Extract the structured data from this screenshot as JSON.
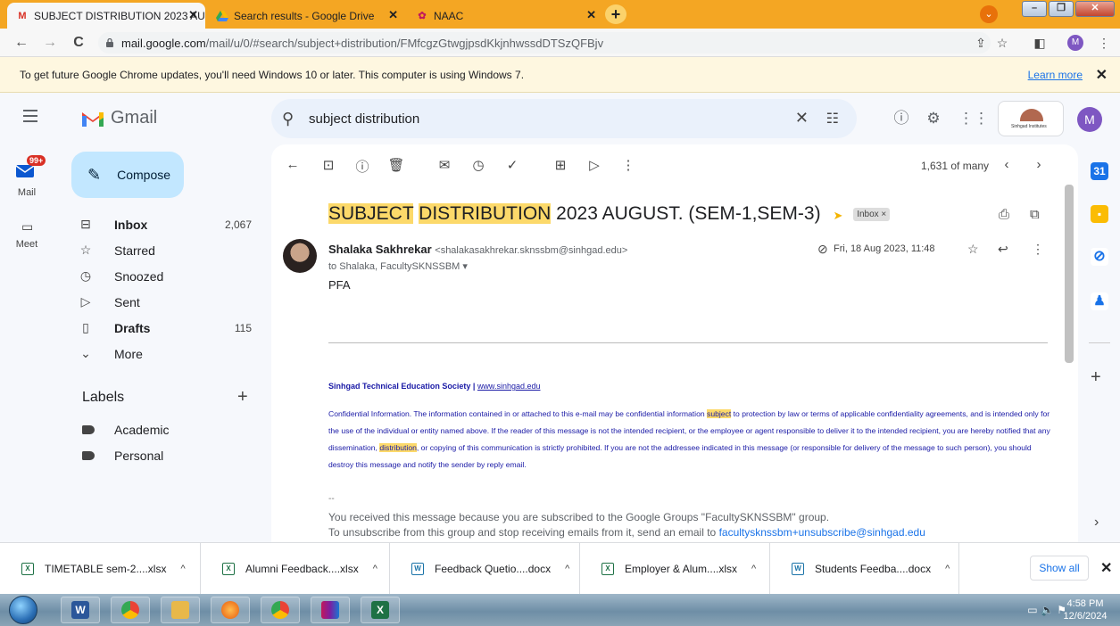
{
  "browser": {
    "tabs": [
      {
        "label": "SUBJECT DISTRIBUTION 2023 AU",
        "active": true
      },
      {
        "label": "Search results - Google Drive",
        "active": false
      },
      {
        "label": "NAAC",
        "active": false
      }
    ],
    "new_tab": "+",
    "profile_initial": "M",
    "url_host": "mail.google.com",
    "url_path": "/mail/u/0/#search/subject+distribution/FMfcgzGtwgjpsdKkjnhwssdDTSzQFBjv"
  },
  "infobar": {
    "text": "To get future Google Chrome updates, you'll need Windows 10 or later. This computer is using Windows 7.",
    "link": "Learn more"
  },
  "gmail": {
    "app_name": "Gmail",
    "search_value": "subject distribution",
    "org_caption": "Sinhgad Institutes",
    "user_initial": "M"
  },
  "rail": {
    "mail_badge": "99+",
    "mail_label": "Mail",
    "meet_label": "Meet"
  },
  "sidebar": {
    "compose": "Compose",
    "items": [
      {
        "label": "Inbox",
        "count": "2,067",
        "bold": true,
        "icon": "inbox-icon"
      },
      {
        "label": "Starred",
        "count": "",
        "bold": false,
        "icon": "star-icon"
      },
      {
        "label": "Snoozed",
        "count": "",
        "bold": false,
        "icon": "clock-icon"
      },
      {
        "label": "Sent",
        "count": "",
        "bold": false,
        "icon": "send-icon"
      },
      {
        "label": "Drafts",
        "count": "115",
        "bold": true,
        "icon": "draft-icon"
      },
      {
        "label": "More",
        "count": "",
        "bold": false,
        "icon": "chevron-down-icon"
      }
    ],
    "labels_heading": "Labels",
    "labels": [
      "Academic",
      "Personal"
    ]
  },
  "message": {
    "pager": "1,631 of many",
    "subject_hl1": "SUBJECT",
    "subject_hl2": "DISTRIBUTION",
    "subject_rest": "2023 AUGUST. (SEM-1,SEM-3)",
    "inbox_chip": "Inbox ×",
    "sender_name": "Shalaka Sakhrekar",
    "sender_email": "<shalakasakhrekar.sknssbm@sinhgad.edu>",
    "to_line": "to Shalaka, FacultySKNSSBM",
    "date": "Fri, 18 Aug 2023, 11:48",
    "body": "PFA",
    "society_name": "Sinhgad Technical Education Society",
    "society_sep": "|",
    "society_url": "www.sinhgad.edu",
    "disclaimer_1": "Confidential Information. The information contained in or attached to this e-mail may be confidential information",
    "disclaimer_hl1": "subject",
    "disclaimer_2": "to protection by law or terms of applicable confidentiality agreements, and is intended only for the use of the individual or entity named above. If the reader of this message is not the intended recipient, or the employee or agent responsible to deliver it to the intended recipient, you are hereby notified that any dissemination,",
    "disclaimer_hl2": "distribution",
    "disclaimer_3": ", or copying of this communication is strictly prohibited. If you are not the addressee indicated in this message (or responsible for delivery of the message to such person), you should destroy this message and notify the sender by reply email.",
    "dashes": "--",
    "groups_line": "You received this message because you are subscribed to the Google Groups \"FacultySKNSSBM\" group.",
    "unsub_line": "To unsubscribe from this group and stop receiving emails from it, send an email to",
    "unsub_link": "facultysknssbm+unsubscribe@sinhgad.edu"
  },
  "downloads": {
    "items": [
      "TIMETABLE sem-2....xlsx",
      "Alumni Feedback....xlsx",
      "Feedback Quetio....docx",
      "Employer & Alum....xlsx",
      "Students Feedba....docx"
    ],
    "show_all": "Show all"
  },
  "taskbar": {
    "time": "4:58 PM",
    "date": "12/6/2024"
  }
}
